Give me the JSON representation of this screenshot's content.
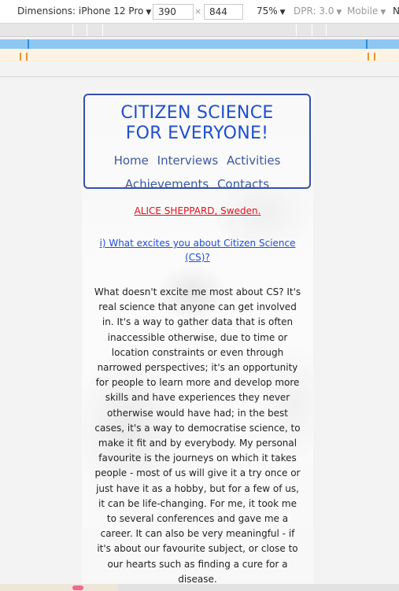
{
  "devtools": {
    "dimensions_label": "Dimensions: iPhone 12 Pro",
    "width_value": "390",
    "times": "×",
    "height_value": "844",
    "zoom": "75%",
    "dpr": "DPR: 3.0",
    "mode": "Mobile",
    "overflow_letter": "N"
  },
  "site": {
    "title_line1": "CITIZEN SCIENCE",
    "title_line2": "FOR EVERYONE!",
    "nav": [
      "Home",
      "Interviews",
      "Activities",
      "Achievements",
      "Contacts"
    ]
  },
  "content": {
    "author": "ALICE SHEPPARD, Sweden.",
    "question": "i) What excites you about Citizen Science (CS)?",
    "answer": "What doesn't excite me most about CS? It's real science that anyone can get involved in. It's a way to gather data that is often inaccessible otherwise, due to time or location constraints or even through narrowed perspectives; it's an opportunity for people to learn more and develop more skills and have experiences they never otherwise would have had; in the best cases, it's a way to democratise science, to make it fit and by everybody. My personal favourite is the journeys on which it takes people - most of us will give it a try once or just have it as a hobby, but for a few of us, it can be life-changing. For me, it took me to several conferences and gave me a career. It can also be very meaningful - if it's about our favourite subject, or close to our hearts such as finding a cure for a disease."
  },
  "colors": {
    "title": "#1f4fd1",
    "nav": "#3a58a6",
    "border": "#3552a6",
    "author": "#e3101a",
    "question": "#1c4fd6"
  }
}
